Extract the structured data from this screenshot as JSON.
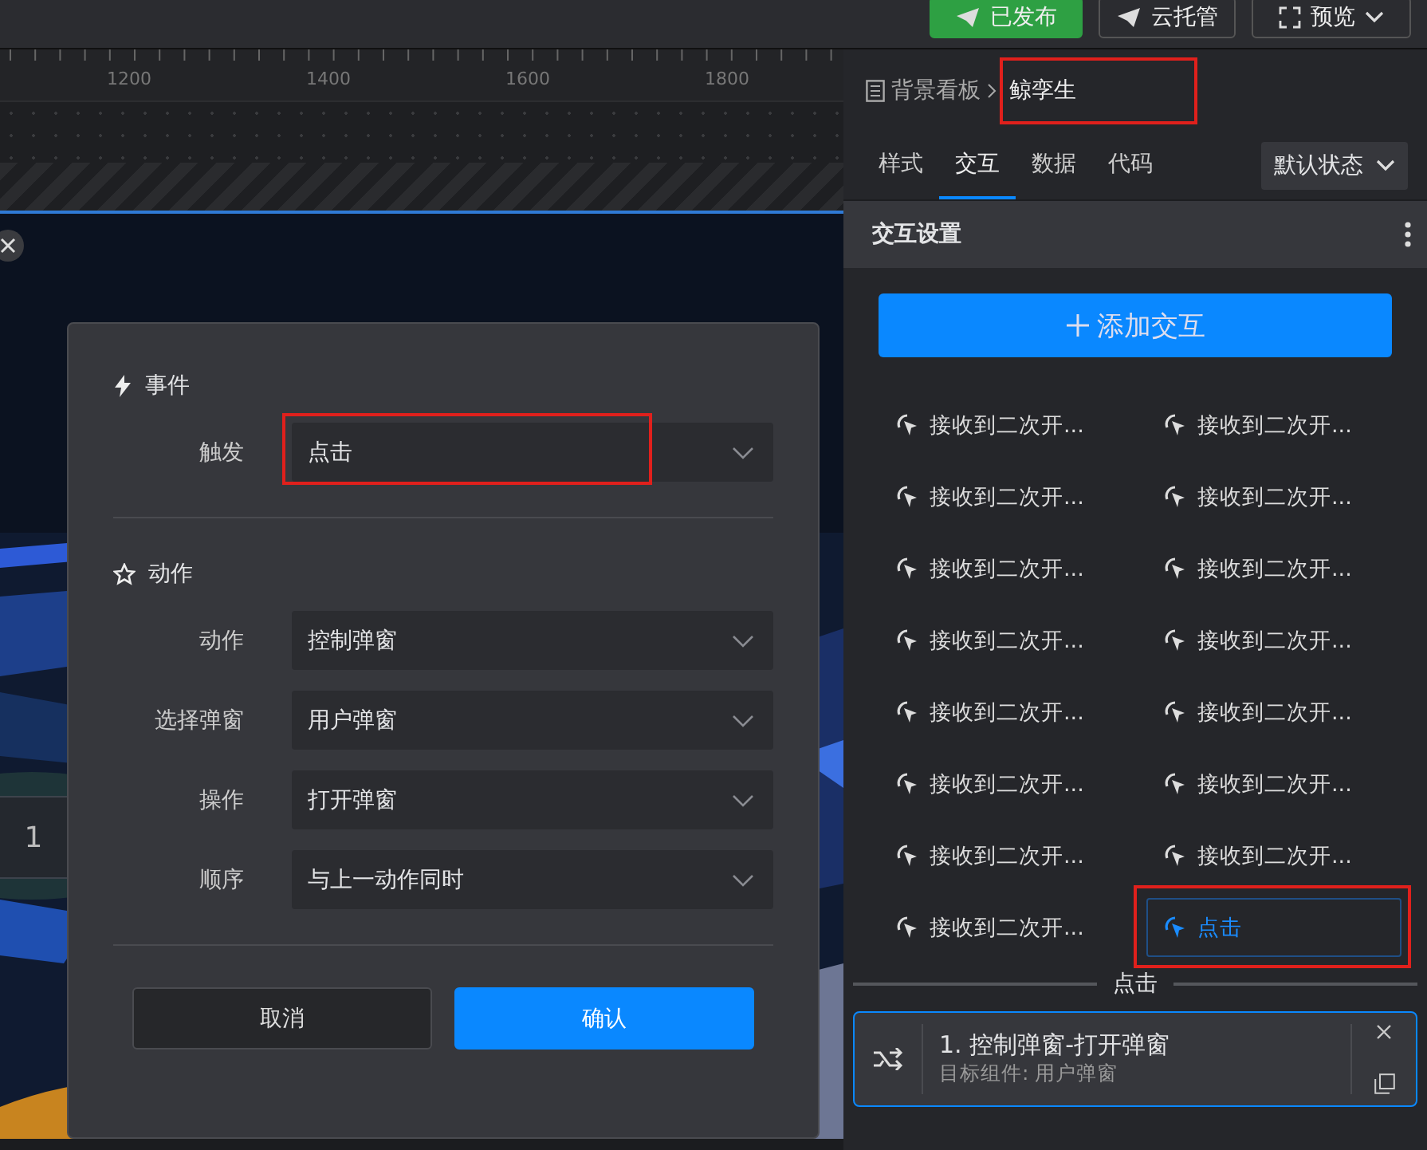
{
  "toolbar": {
    "buttons": [
      {
        "label": "已发布",
        "kind": "publish"
      },
      {
        "label": "云托管",
        "kind": "cloud"
      },
      {
        "label": "预览",
        "kind": "preview"
      }
    ]
  },
  "ruler": {
    "labels": [
      "1200",
      "1400",
      "1600",
      "1800"
    ]
  },
  "canvas": {
    "kind": "picture",
    "widget_text": "1"
  },
  "dialog": {
    "sections": [
      {
        "title": "事件",
        "kind": "event",
        "fields": [
          {
            "label": "触发",
            "value": "点击",
            "highlighted": true
          }
        ]
      },
      {
        "title": "动作",
        "kind": "action",
        "fields": [
          {
            "label": "动作",
            "value": "控制弹窗",
            "highlighted": false
          },
          {
            "label": "选择弹窗",
            "value": "用户弹窗",
            "highlighted": false
          },
          {
            "label": "操作",
            "value": "打开弹窗",
            "highlighted": false
          },
          {
            "label": "顺序",
            "value": "与上一动作同时",
            "highlighted": false
          }
        ]
      }
    ],
    "buttons": [
      {
        "label": "取消",
        "kind": "secondary"
      },
      {
        "label": "确认",
        "kind": "primary"
      }
    ]
  },
  "panel": {
    "breadcrumb": {
      "parent": "背景看板",
      "current": "鲸孪生",
      "highlighted": true
    },
    "tabs": [
      {
        "label": "样式",
        "selected": false
      },
      {
        "label": "交互",
        "selected": true
      },
      {
        "label": "数据",
        "selected": false
      },
      {
        "label": "代码",
        "selected": false
      }
    ],
    "state_select": "默认状态",
    "section_title": "交互设置",
    "add_button": "添加交互",
    "interactions": [
      {
        "label": "接收到二次开...",
        "selected": false,
        "highlighted": false
      },
      {
        "label": "接收到二次开...",
        "selected": false,
        "highlighted": false
      },
      {
        "label": "接收到二次开...",
        "selected": false,
        "highlighted": false
      },
      {
        "label": "接收到二次开...",
        "selected": false,
        "highlighted": false
      },
      {
        "label": "接收到二次开...",
        "selected": false,
        "highlighted": false
      },
      {
        "label": "接收到二次开...",
        "selected": false,
        "highlighted": false
      },
      {
        "label": "接收到二次开...",
        "selected": false,
        "highlighted": false
      },
      {
        "label": "接收到二次开...",
        "selected": false,
        "highlighted": false
      },
      {
        "label": "接收到二次开...",
        "selected": false,
        "highlighted": false
      },
      {
        "label": "接收到二次开...",
        "selected": false,
        "highlighted": false
      },
      {
        "label": "接收到二次开...",
        "selected": false,
        "highlighted": false
      },
      {
        "label": "接收到二次开...",
        "selected": false,
        "highlighted": false
      },
      {
        "label": "接收到二次开...",
        "selected": false,
        "highlighted": false
      },
      {
        "label": "接收到二次开...",
        "selected": false,
        "highlighted": false
      },
      {
        "label": "接收到二次开...",
        "selected": false,
        "highlighted": false
      },
      {
        "label": "点击",
        "selected": true,
        "highlighted": true
      }
    ],
    "divider_label": "点击",
    "action_card": {
      "title": "1. 控制弹窗-打开弹窗",
      "subtitle": "目标组件: 用户弹窗"
    }
  }
}
